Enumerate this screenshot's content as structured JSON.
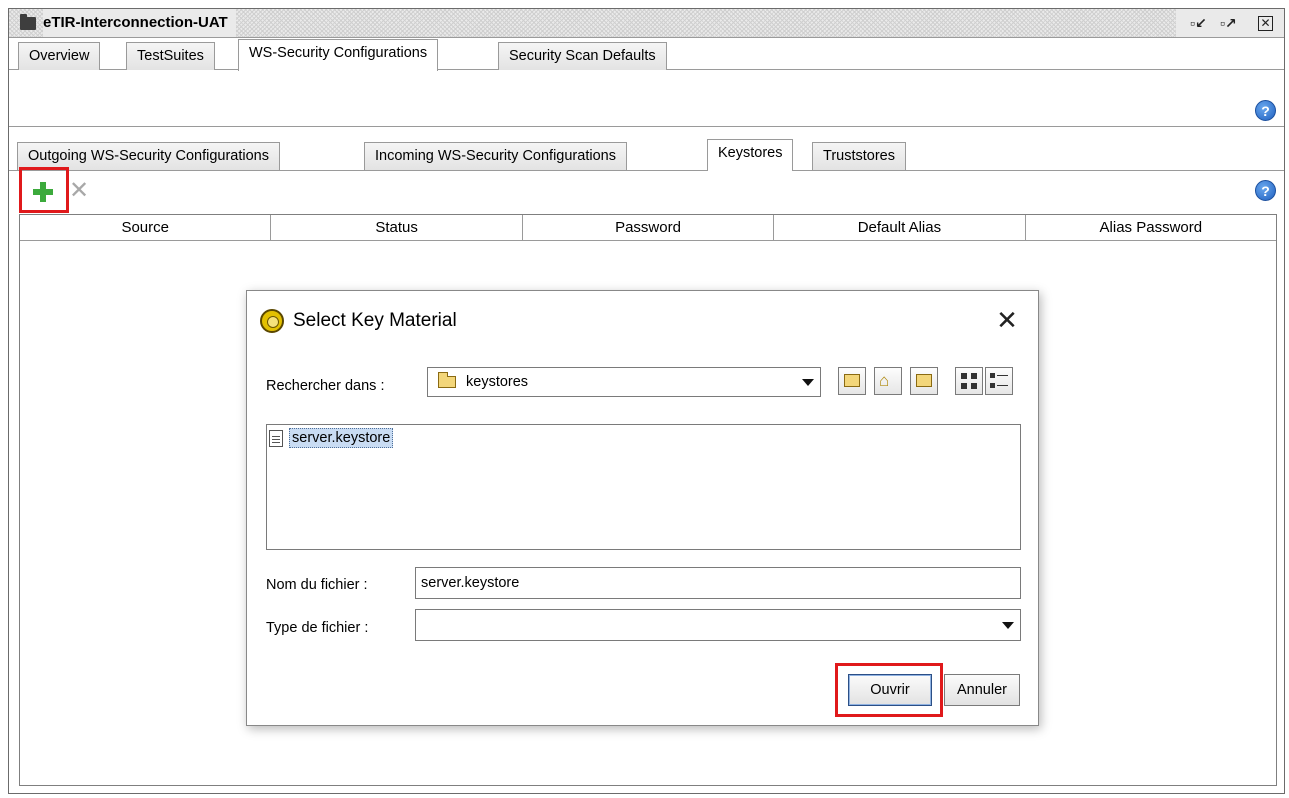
{
  "window": {
    "title": "eTIR-Interconnection-UAT"
  },
  "tabs": [
    {
      "label": "Overview"
    },
    {
      "label": "TestSuites"
    },
    {
      "label": "WS-Security Configurations"
    },
    {
      "label": "Security Scan Defaults"
    }
  ],
  "active_tab": "WS-Security Configurations",
  "sub_tabs": [
    {
      "label": "Outgoing WS-Security Configurations"
    },
    {
      "label": "Incoming WS-Security Configurations"
    },
    {
      "label": "Keystores"
    },
    {
      "label": "Truststores"
    }
  ],
  "active_sub_tab": "Keystores",
  "toolbar": {
    "add_icon": "plus-icon",
    "remove_icon": "x-icon",
    "help_icon": "help-icon"
  },
  "table": {
    "columns": [
      "Source",
      "Status",
      "Password",
      "Default Alias",
      "Alias Password"
    ],
    "rows": []
  },
  "dialog": {
    "title": "Select Key Material",
    "look_in_label": "Rechercher dans :",
    "look_in_value": "keystores",
    "files": [
      {
        "name": "server.keystore"
      }
    ],
    "filename_label": "Nom du fichier :",
    "filename_value": "server.keystore",
    "filetype_label": "Type de fichier :",
    "filetype_value": "",
    "open_button": "Ouvrir",
    "cancel_button": "Annuler"
  },
  "colors": {
    "highlight": "#e0191b",
    "add_green": "#3caa3c",
    "selection": "#c9dcf3"
  }
}
